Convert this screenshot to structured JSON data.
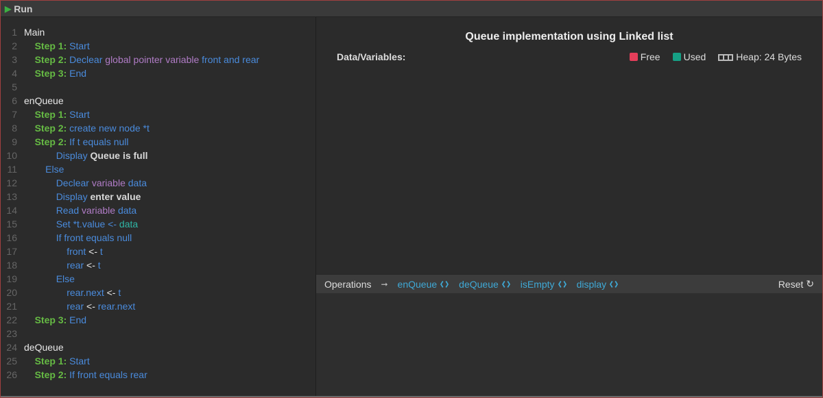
{
  "toolbar": {
    "run_label": "Run"
  },
  "editor": {
    "lines": [
      {
        "n": 1,
        "tokens": [
          [
            "Main",
            "c-white"
          ]
        ]
      },
      {
        "n": 2,
        "indent": 1,
        "tokens": [
          [
            "Step 1: ",
            "c-step"
          ],
          [
            "Start",
            "c-blue"
          ]
        ]
      },
      {
        "n": 3,
        "indent": 1,
        "tokens": [
          [
            "Step 2: ",
            "c-step"
          ],
          [
            "Declear ",
            "c-blue"
          ],
          [
            "global pointer variable ",
            "c-purple"
          ],
          [
            "front and rear",
            "c-blue"
          ]
        ]
      },
      {
        "n": 4,
        "indent": 1,
        "tokens": [
          [
            "Step 3: ",
            "c-step"
          ],
          [
            "End",
            "c-blue"
          ]
        ]
      },
      {
        "n": 5,
        "tokens": []
      },
      {
        "n": 6,
        "tokens": [
          [
            "enQueue",
            "c-white"
          ]
        ]
      },
      {
        "n": 7,
        "indent": 1,
        "tokens": [
          [
            "Step 1: ",
            "c-step"
          ],
          [
            "Start",
            "c-blue"
          ]
        ]
      },
      {
        "n": 8,
        "indent": 1,
        "tokens": [
          [
            "Step 2: ",
            "c-step"
          ],
          [
            "create new node *t",
            "c-blue"
          ]
        ]
      },
      {
        "n": 9,
        "indent": 1,
        "tokens": [
          [
            "Step 2: ",
            "c-step"
          ],
          [
            "If t equals null",
            "c-blue"
          ]
        ]
      },
      {
        "n": 10,
        "indent": 3,
        "tokens": [
          [
            "Display ",
            "c-blue"
          ],
          [
            "Queue is full",
            "c-str"
          ]
        ]
      },
      {
        "n": 11,
        "indent": 2,
        "tokens": [
          [
            "Else",
            "c-blue"
          ]
        ]
      },
      {
        "n": 12,
        "indent": 3,
        "tokens": [
          [
            "Declear ",
            "c-blue"
          ],
          [
            "variable ",
            "c-purple"
          ],
          [
            "data",
            "c-blue"
          ]
        ]
      },
      {
        "n": 13,
        "indent": 3,
        "tokens": [
          [
            "Display ",
            "c-blue"
          ],
          [
            "enter value",
            "c-str"
          ]
        ]
      },
      {
        "n": 14,
        "indent": 3,
        "tokens": [
          [
            "Read ",
            "c-blue"
          ],
          [
            "variable ",
            "c-purple"
          ],
          [
            "data",
            "c-blue"
          ]
        ]
      },
      {
        "n": 15,
        "indent": 3,
        "tokens": [
          [
            "Set *t.value <- ",
            "c-blue"
          ],
          [
            "data",
            "c-teal"
          ]
        ]
      },
      {
        "n": 16,
        "indent": 3,
        "tokens": [
          [
            "If front equals null",
            "c-blue"
          ]
        ]
      },
      {
        "n": 17,
        "indent": 4,
        "tokens": [
          [
            "front ",
            "c-blue"
          ],
          [
            "<- ",
            "c-white"
          ],
          [
            "t",
            "c-blue"
          ]
        ]
      },
      {
        "n": 18,
        "indent": 4,
        "tokens": [
          [
            "rear ",
            "c-blue"
          ],
          [
            "<- ",
            "c-white"
          ],
          [
            "t",
            "c-blue"
          ]
        ]
      },
      {
        "n": 19,
        "indent": 3,
        "tokens": [
          [
            "Else",
            "c-blue"
          ]
        ]
      },
      {
        "n": 20,
        "indent": 4,
        "tokens": [
          [
            "rear.next ",
            "c-blue"
          ],
          [
            "<- ",
            "c-white"
          ],
          [
            "t",
            "c-blue"
          ]
        ]
      },
      {
        "n": 21,
        "indent": 4,
        "tokens": [
          [
            "rear ",
            "c-blue"
          ],
          [
            "<- ",
            "c-white"
          ],
          [
            "rear.next",
            "c-blue"
          ]
        ]
      },
      {
        "n": 22,
        "indent": 1,
        "tokens": [
          [
            "Step 3: ",
            "c-step"
          ],
          [
            "End",
            "c-blue"
          ]
        ]
      },
      {
        "n": 23,
        "tokens": []
      },
      {
        "n": 24,
        "tokens": [
          [
            "deQueue",
            "c-white"
          ]
        ]
      },
      {
        "n": 25,
        "indent": 1,
        "tokens": [
          [
            "Step 1: ",
            "c-step"
          ],
          [
            "Start",
            "c-blue"
          ]
        ]
      },
      {
        "n": 26,
        "indent": 1,
        "tokens": [
          [
            "Step 2: ",
            "c-step"
          ],
          [
            "If front equals rear",
            "c-blue"
          ]
        ]
      }
    ]
  },
  "visualizer": {
    "title": "Queue implementation using Linked list",
    "datavars_label": "Data/Variables:",
    "legend": {
      "free": "Free",
      "used": "Used"
    },
    "heap_label": "Heap: 24 Bytes"
  },
  "operations": {
    "label": "Operations",
    "items": [
      "enQueue",
      "deQueue",
      "isEmpty",
      "display"
    ],
    "reset_label": "Reset"
  }
}
